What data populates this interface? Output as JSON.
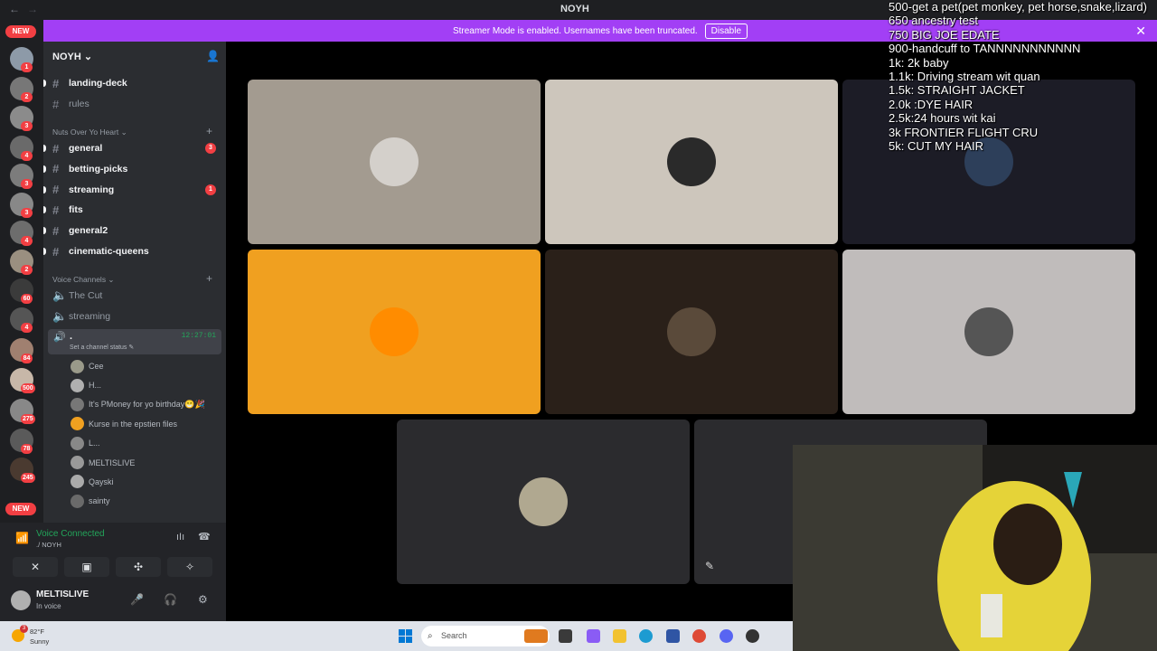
{
  "window": {
    "title": "NOYH",
    "back": "←",
    "forward": "→"
  },
  "banner": {
    "text": "Streamer Mode is enabled. Usernames have been truncated.",
    "button": "Disable",
    "close": "✕"
  },
  "guilds": {
    "new_top": "NEW",
    "new_bottom": "NEW",
    "badges": [
      "1",
      "2",
      "3",
      "4",
      "3",
      "3",
      "4",
      "2",
      "60",
      "4",
      "84",
      "500",
      "275",
      "78",
      "245"
    ]
  },
  "server": {
    "name": "NOYH ⌄",
    "invite_icon": "person-add-icon"
  },
  "channels": {
    "top": [
      {
        "name": "landing-deck",
        "bold": true
      },
      {
        "name": "rules",
        "bold": false
      }
    ],
    "category1": "Nuts Over Yo Heart ⌄",
    "category1_plus": "+",
    "list1": [
      {
        "name": "general",
        "bold": true,
        "mention": "3"
      },
      {
        "name": "betting-picks",
        "bold": true,
        "mention": ""
      },
      {
        "name": "streaming",
        "bold": true,
        "mention": "1"
      },
      {
        "name": "fits",
        "bold": true,
        "mention": ""
      },
      {
        "name": "general2",
        "bold": true,
        "mention": ""
      },
      {
        "name": "cinematic-queens",
        "bold": true,
        "mention": ""
      }
    ],
    "voice_category": "Voice Channels ⌄",
    "voice_plus": "+",
    "voice": [
      {
        "name": "The Cut"
      },
      {
        "name": "streaming"
      }
    ],
    "active_voice": {
      "name": ".",
      "timer": "12:27:01",
      "status": "Set a channel status ✎"
    },
    "voice_users": [
      "Cee",
      "H...",
      "It's PMoney for yo birthday😁🎉",
      "Kurse in the epstien files",
      "L...",
      "MELTISLIVE",
      "Qayski",
      "sainty"
    ]
  },
  "panel": {
    "voice_status": "Voice Connected",
    "voice_location": "./ NOYH",
    "buttons": [
      "✕",
      "▣",
      "✣",
      "✧"
    ],
    "user_name": "MELTISLIVE",
    "user_status": "In voice",
    "icons": [
      "🎤",
      "🎧",
      "⚙"
    ]
  },
  "stage": {
    "tiles": [
      {
        "bg": "#a39b90",
        "av": "#d4d0cb"
      },
      {
        "bg": "#cdc6bc",
        "av": "#2a2a2a"
      },
      {
        "bg": "#1c1c26",
        "av": "#2d3f5a"
      },
      {
        "bg": "#f0a020",
        "av": "#ff8c00"
      },
      {
        "bg": "#2a2019",
        "av": "#5a4a3a"
      },
      {
        "bg": "#c0bcbb",
        "av": "#555555"
      },
      {
        "bg": "#2b2b2e",
        "av": "#b0a890"
      },
      {
        "bg": "#2b2b2e",
        "av": ""
      }
    ]
  },
  "overlay": {
    "lines": [
      "500-get a pet(pet monkey, pet horse,snake,lizard)",
      "650 ancestry test",
      "750 BIG JOE EDATE",
      "900-handcuff to TANNNNNNNNNNN",
      "1k: 2k baby",
      "1.1k: Driving stream wit quan",
      "1.5k: STRAIGHT JACKET",
      "2.0k :DYE HAIR",
      "2.5k:24 hours wit kai",
      "3k FRONTIER FLIGHT CRU",
      "5k: CUT MY HAIR"
    ]
  },
  "taskbar": {
    "temp": "82°F",
    "condition": "Sunny",
    "weather_badge": "3",
    "search": "Search"
  }
}
